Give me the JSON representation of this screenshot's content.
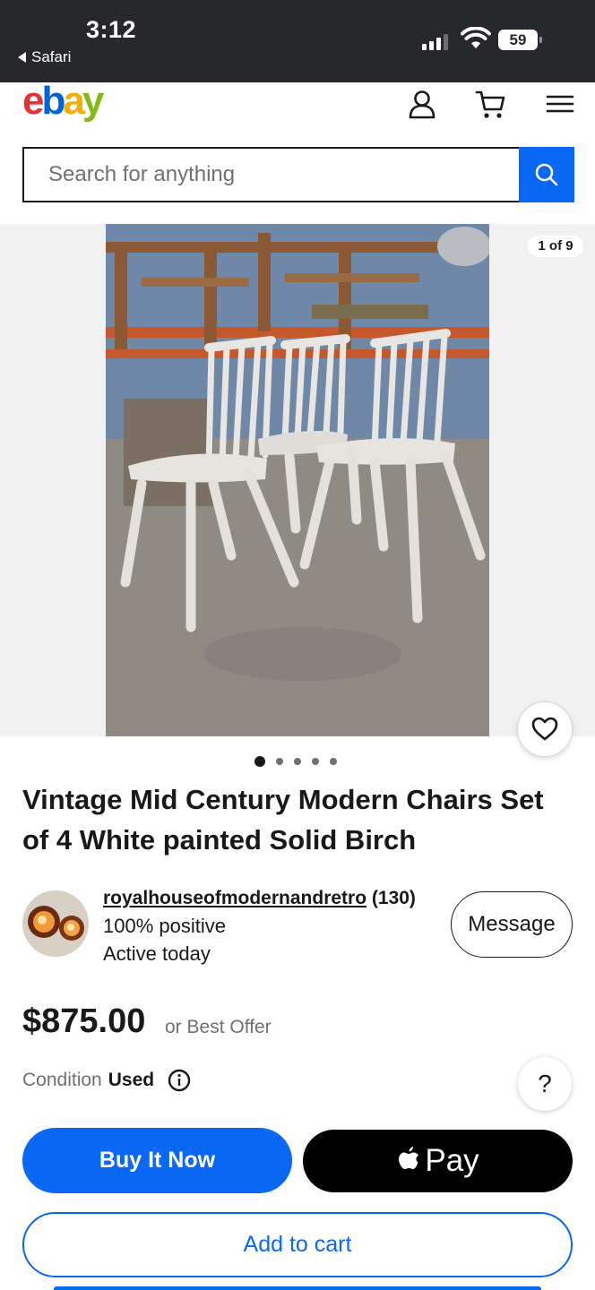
{
  "status_bar": {
    "time": "3:12",
    "back_app": "Safari",
    "battery": "59"
  },
  "header": {
    "logo": {
      "e": "e",
      "b": "b",
      "a": "a",
      "y": "y"
    },
    "icons": [
      "account-icon",
      "cart-icon",
      "menu-icon"
    ]
  },
  "search": {
    "placeholder": "Search for anything"
  },
  "gallery": {
    "counter": "1 of 9",
    "dots_total": 5,
    "dots_active_index": 0
  },
  "listing": {
    "title": "Vintage Mid Century Modern Chairs Set of 4 White painted Solid Birch",
    "seller": {
      "name": "royalhouseofmodernandretro",
      "feedback_count": "(130)",
      "positive": "100% positive",
      "activity": "Active today",
      "message_label": "Message"
    },
    "price": "$875.00",
    "best_offer": "or Best Offer",
    "condition_label": "Condition",
    "condition_value": "Used",
    "help_label": "?"
  },
  "actions": {
    "buy_now": "Buy It Now",
    "apple_pay": "Pay",
    "add_to_cart": "Add to cart"
  },
  "colors": {
    "primary_blue": "#0968f6",
    "status_bar": "#26282b"
  }
}
